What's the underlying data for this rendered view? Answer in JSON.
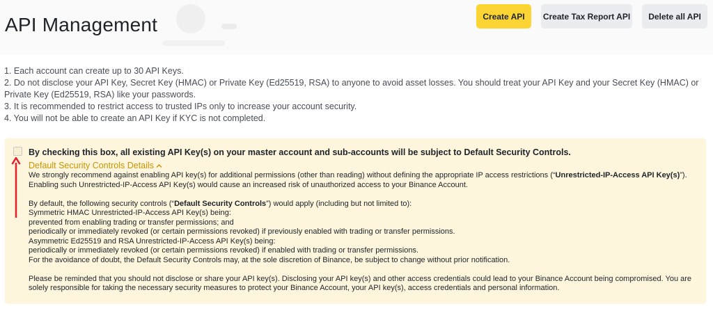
{
  "header": {
    "title": "API Management",
    "buttons": {
      "create_api": "Create API",
      "create_tax_report_api": "Create Tax Report API",
      "delete_all_api": "Delete all API"
    }
  },
  "notes": [
    "1. Each account can create up to 30 API Keys.",
    "2. Do not disclose your API Key, Secret Key (HMAC) or Private Key (Ed25519, RSA) to anyone to avoid asset losses. You should treat your API Key and your Secret Key (HMAC) or Private Key (Ed25519, RSA) like your passwords.",
    "3. It is recommended to restrict access to trusted IPs only to increase your account security.",
    "4. You will not be able to create an API Key if KYC is not completed."
  ],
  "security_controls": {
    "checkbox_checked": false,
    "checkbox_label": "By checking this box, all existing API Key(s) on your master account and sub-accounts will be subject to Default Security Controls.",
    "details_link": "Default Security Controls Details",
    "para1_pre": "We strongly recommend against enabling API key(s) for additional permissions (other than reading) without defining the appropriate IP access restrictions (“",
    "para1_bold": "Unrestricted-IP-Access API Key(s)",
    "para1_post": "”). Enabling such Unrestricted-IP-Access API Key(s) would cause an increased risk of unauthorized access to your Binance Account.",
    "para2_pre": "By default, the following security controls (“",
    "para2_bold": "Default Security Controls",
    "para2_post": "”) would apply (including but not limited to):",
    "lines": [
      "Symmetric HMAC Unrestricted-IP-Access API Key(s) being:",
      "prevented from enabling trading or transfer permissions; and",
      "periodically or immediately revoked (or certain permissions revoked) if previously enabled with trading or transfer permissions.",
      "Asymmetric Ed25519 and RSA Unrestricted-IP-Access API Key(s) being:",
      "periodically or immediately revoked (or certain permissions revoked) if enabled with trading or transfer permissions.",
      "For the avoidance of doubt, the Default Security Controls may, at the sole discretion of Binance, be subject to change without prior notification."
    ],
    "reminder": "Please be reminded that you should not disclose or share your API key(s). Disclosing your API key(s) and other access credentials could lead to your Binance Account being compromised. You are solely responsible for taking the necessary security measures to protect your Binance Account, your API key(s), access credentials and personal information."
  },
  "colors": {
    "primary_button": "#fcd535",
    "secondary_button": "#eaecef",
    "notice_background": "#fdf6dd",
    "link": "#c99400",
    "annotation_arrow": "#e0202a"
  },
  "icons": {
    "details_toggle": "chevron-up-icon",
    "annotation": "red-arrow-up-icon"
  }
}
